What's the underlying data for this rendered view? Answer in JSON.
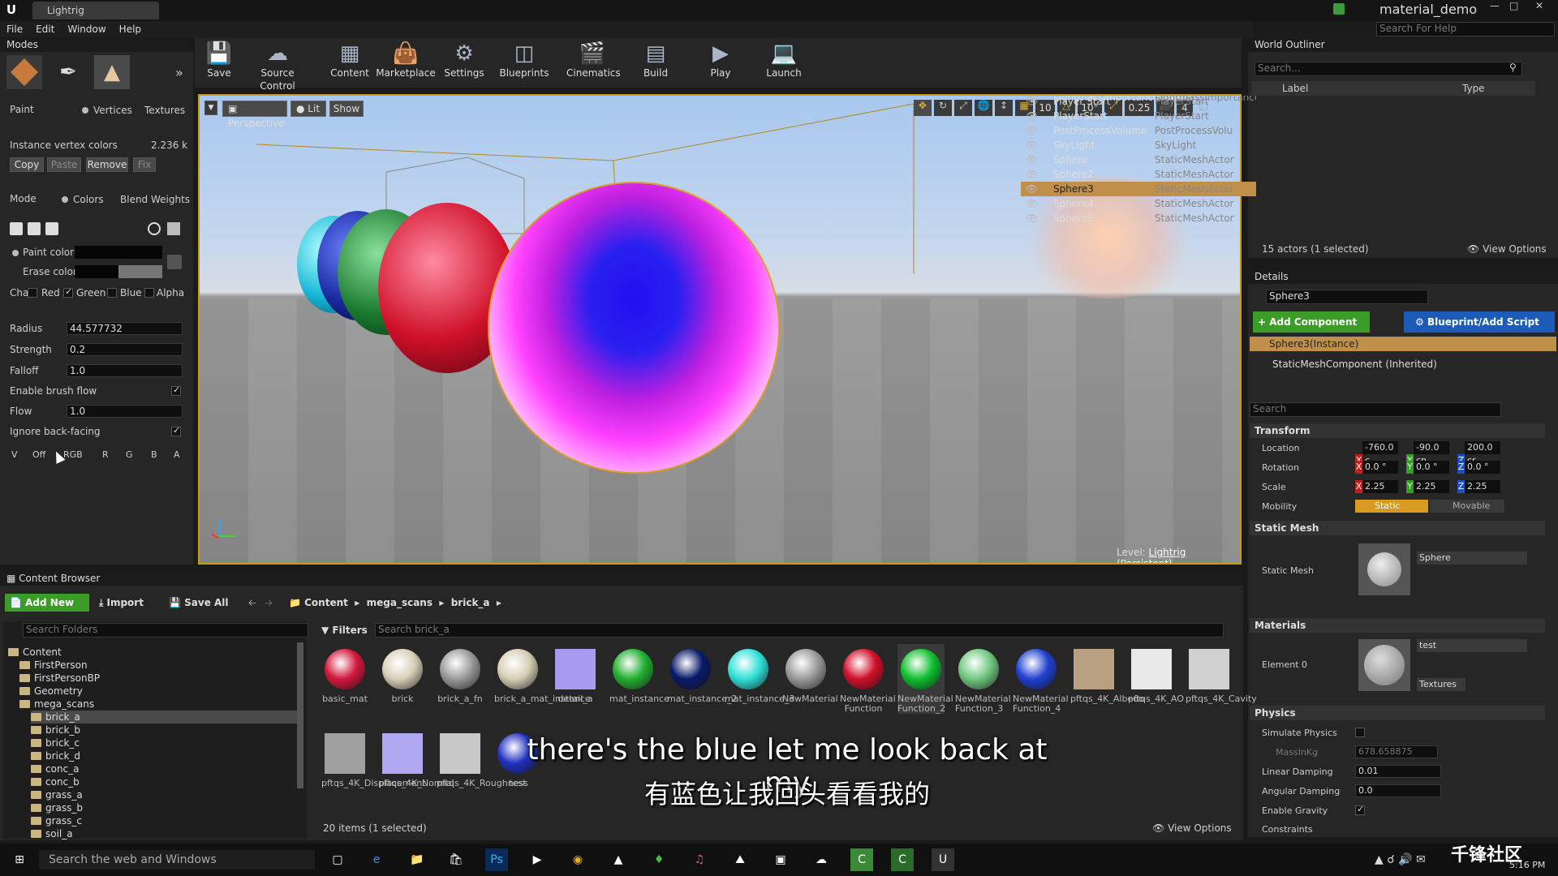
{
  "window": {
    "tab": "Lightrig",
    "project": "material_demo",
    "search_help": "Search For Help"
  },
  "menu": [
    "File",
    "Edit",
    "Window",
    "Help"
  ],
  "modes": {
    "tab": "Modes",
    "paint_label": "Paint",
    "vertices": "Vertices",
    "textures": "Textures",
    "instance_vertex_colors": "Instance vertex colors",
    "instance_size": "2.236 k",
    "buttons": [
      "Copy",
      "Paste",
      "Remove",
      "Fix"
    ],
    "mode_label": "Mode",
    "colors": "Colors",
    "blend_weights": "Blend Weights",
    "paint_color": "Paint color",
    "erase_color": "Erase color",
    "channels_label": "Cha",
    "channels": [
      "Red",
      "Green",
      "Blue",
      "Alpha"
    ],
    "radius_label": "Radius",
    "radius": "44.577732",
    "strength_label": "Strength",
    "strength": "0.2",
    "falloff_label": "Falloff",
    "falloff": "1.0",
    "enable_brush_flow": "Enable brush flow",
    "flow_label": "Flow",
    "flow": "1.0",
    "ignore_backfacing": "Ignore back-facing",
    "view_modes": [
      "V",
      "Off",
      "RGB",
      "R",
      "G",
      "B",
      "A"
    ]
  },
  "toolbar": [
    "Save",
    "Source Control",
    "Content",
    "Marketplace",
    "Settings",
    "Blueprints",
    "Cinematics",
    "Build",
    "Play",
    "Launch"
  ],
  "viewport": {
    "perspective": "Perspective",
    "lit": "Lit",
    "show": "Show",
    "grid_snap": "10",
    "rot_snap": "10°",
    "scale_snap": "0.25",
    "cam_speed": "4",
    "level_label": "Level:",
    "level_name": "Lightrig (Persistent)"
  },
  "subtitles": {
    "en": "there's the blue let me look back at my",
    "zh": "有蓝色让我回头看看我的"
  },
  "outliner": {
    "tab": "World Outliner",
    "search_placeholder": "Search...",
    "col_label": "Label",
    "col_type": "Type",
    "rows": [
      {
        "label": "LightmassImportanceVolume",
        "type": "LightmassImportance"
      },
      {
        "label": "Player Start",
        "type": "PlayerStart"
      },
      {
        "label": "PlayerStart",
        "type": "PlayerStart"
      },
      {
        "label": "PostProcessVolume",
        "type": "PostProcessVolu"
      },
      {
        "label": "SkyLight",
        "type": "SkyLight"
      },
      {
        "label": "Sphere",
        "type": "StaticMeshActor"
      },
      {
        "label": "Sphere2",
        "type": "StaticMeshActor"
      },
      {
        "label": "Sphere3",
        "type": "StaticMeshActor"
      },
      {
        "label": "Sphere4",
        "type": "StaticMeshActor"
      },
      {
        "label": "Sphere5",
        "type": "StaticMeshActor"
      }
    ],
    "status": "15 actors (1 selected)",
    "view_options": "View Options"
  },
  "details": {
    "tab": "Details",
    "name": "Sphere3",
    "add_component": "+ Add Component",
    "blueprint": "Blueprint/Add Script",
    "instance": "Sphere3(Instance)",
    "component": "StaticMeshComponent (Inherited)",
    "search_placeholder": "Search",
    "transform": "Transform",
    "location_label": "Location",
    "location": [
      "-760.0 c",
      "-90.0 cn",
      "200.0 cr"
    ],
    "rotation_label": "Rotation",
    "rotation": [
      "0.0 °",
      "0.0 °",
      "0.0 °"
    ],
    "scale_label": "Scale",
    "scale": [
      "2.25",
      "2.25",
      "2.25"
    ],
    "mobility_label": "Mobility",
    "static": "Static",
    "movable": "Movable",
    "static_mesh_section": "Static Mesh",
    "static_mesh_label": "Static Mesh",
    "mesh": "Sphere",
    "materials_section": "Materials",
    "element0": "Element 0",
    "material": "test",
    "textures": "Textures",
    "physics_section": "Physics",
    "simulate_physics": "Simulate Physics",
    "mass_label": "MassInKg",
    "mass": "678.658875",
    "linear_damping_label": "Linear Damping",
    "linear_damping": "0.01",
    "angular_damping_label": "Angular Damping",
    "angular_damping": "0.0",
    "enable_gravity": "Enable Gravity",
    "constraints": "Constraints"
  },
  "content_browser": {
    "tab": "Content Browser",
    "add_new": "Add New",
    "import": "Import",
    "save_all": "Save All",
    "path": [
      "Content",
      "mega_scans",
      "brick_a"
    ],
    "search_folders": "Search Folders",
    "filters": "Filters",
    "search_placeholder": "Search brick_a",
    "tree": [
      "Content",
      "FirstPerson",
      "FirstPersonBP",
      "Geometry",
      "mega_scans",
      "brick_a",
      "brick_b",
      "brick_c",
      "brick_d",
      "conc_a",
      "conc_b",
      "grass_a",
      "grass_b",
      "grass_c",
      "soil_a"
    ],
    "assets": [
      {
        "name": "basic_mat",
        "color": "#d2183c"
      },
      {
        "name": "brick",
        "color": "#d8d0b8"
      },
      {
        "name": "brick_a_fn",
        "color": "#9a9a9a"
      },
      {
        "name": "brick_a_mat_instance",
        "color": "#d6ceb4"
      },
      {
        "name": "detail_a",
        "color": "#a89af0"
      },
      {
        "name": "mat_instance",
        "color": "#22b030"
      },
      {
        "name": "mat_instance_2",
        "color": "#0a1a6a"
      },
      {
        "name": "mat_instance_3",
        "color": "#30e0d8"
      },
      {
        "name": "NewMaterial",
        "color": "#9a9a9a"
      },
      {
        "name": "NewMaterial Function",
        "color": "#d0102a"
      },
      {
        "name": "NewMaterial Function_2",
        "color": "#10c030"
      },
      {
        "name": "NewMaterial Function_3",
        "color": "#70c880"
      },
      {
        "name": "NewMaterial Function_4",
        "color": "#2040d0"
      },
      {
        "name": "pftqs_4K_Albedo",
        "color": "#b8a080"
      },
      {
        "name": "pftqs_4K_AO",
        "color": "#e8e8e8"
      },
      {
        "name": "pftqs_4K_Cavity",
        "color": "#d0d0d0"
      },
      {
        "name": "pftqs_4K_Displacement",
        "color": "#a0a0a0"
      },
      {
        "name": "pftqs_4K_Normal",
        "color": "#b0a8f0"
      },
      {
        "name": "pftqs_4K_Roughness",
        "color": "#c8c8c8"
      },
      {
        "name": "test",
        "color": "#2030c0"
      }
    ],
    "status": "20 items (1 selected)",
    "view_options": "View Options"
  },
  "taskbar": {
    "search": "Search the web and Windows",
    "clock": "5:16 PM",
    "watermark": "千锋社区"
  }
}
